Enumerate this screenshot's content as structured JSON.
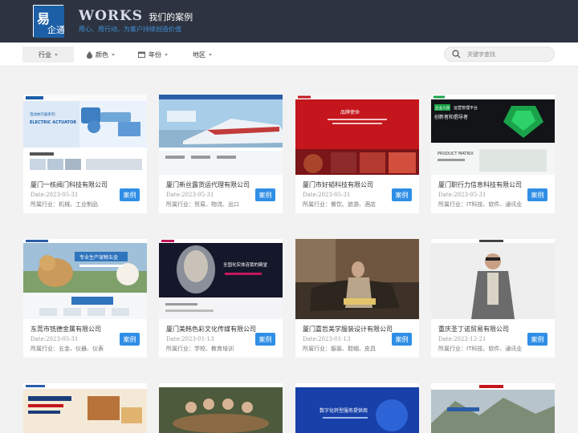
{
  "header": {
    "logo_text": "易企通",
    "works": "WORKS",
    "title": "我们的案例",
    "tagline": "用心、用行动、为客户持续创造价值"
  },
  "filters": [
    {
      "label": "行业",
      "icon": "none"
    },
    {
      "label": "颜色",
      "icon": "drop-icon"
    },
    {
      "label": "年份",
      "icon": "calendar-icon"
    },
    {
      "label": "地区",
      "icon": "none"
    }
  ],
  "search": {
    "placeholder": "关键字查找"
  },
  "badge_label": "案例",
  "cards": [
    {
      "title": "厦门一核阀门科技有限公司",
      "date": "Date:2023-05-31",
      "industry": "所属行业：机械、工业制品",
      "thumb": "valve"
    },
    {
      "title": "厦门新丝露货运代理有限公司",
      "date": "Date:2023-05-31",
      "industry": "所属行业：贸易、物流、出口",
      "thumb": "train"
    },
    {
      "title": "厦门市好韬科技有限公司",
      "date": "Date:2023-05-31",
      "industry": "所属行业：餐饮、旅游、酒店",
      "thumb": "red"
    },
    {
      "title": "厦门职行力信息科技有限公司",
      "date": "Date:2023-05-31",
      "industry": "所属行业：IT科技、软件、通讯业",
      "thumb": "green"
    },
    {
      "title": "东莞市铣德金属有限公司",
      "date": "Date:2023-05-31",
      "industry": "所属行业：五金、仪器、仪表",
      "thumb": "dog"
    },
    {
      "title": "厦门美韩色彩文化传媒有限公司",
      "date": "Date:2023-01-13",
      "industry": "所属行业：学校、教育培训",
      "thumb": "face"
    },
    {
      "title": "厦门嘉哲美学服装设计有限公司",
      "date": "Date:2023-01-13",
      "industry": "所属行业：服装、鞋帽、皮具",
      "thumb": "fashion"
    },
    {
      "title": "重庆圣丁诺贸易有限公司",
      "date": "Date:2022-12-21",
      "industry": "所属行业：IT科技、软件、通讯业",
      "thumb": "man"
    },
    {
      "title": "",
      "date": "",
      "industry": "",
      "thumb": "law"
    },
    {
      "title": "",
      "date": "",
      "industry": "",
      "thumb": "dinner"
    },
    {
      "title": "",
      "date": "",
      "industry": "",
      "thumb": "digital"
    },
    {
      "title": "",
      "date": "",
      "industry": "",
      "thumb": "mountain"
    }
  ],
  "thumb_text": {
    "valve_tag": "ELECTRIC ACTUATOR",
    "red_slogan": "品牌使命",
    "green_slogan1": "企业人效",
    "green_slogan2": "运营管理平台",
    "green_slogan3": "创新者和倡导者",
    "green_slogan4": "PRODUCT MATRIX",
    "face_slogan": "全国化实体连锁的殿堂",
    "digital_slogan": "数字化转型服务提供商",
    "dog_slogan": "专业生产宠物五金"
  }
}
